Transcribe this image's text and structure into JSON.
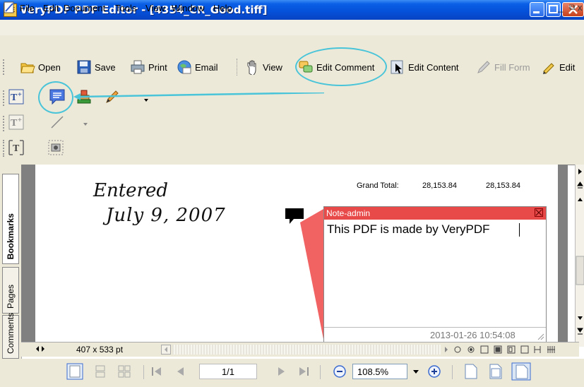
{
  "window": {
    "title": "VeryPDF PDF Editor - [4354_CR_Good.tiff]",
    "app_icon_text": "PE"
  },
  "menu": {
    "items": [
      "File",
      "Edit",
      "Document",
      "Tools",
      "View",
      "Window",
      "Help"
    ],
    "mdi_controls": [
      "_",
      "⧉",
      "x"
    ]
  },
  "toolbar": {
    "open": "Open",
    "save": "Save",
    "print": "Print",
    "email": "Email",
    "view": "View",
    "edit_comment": "Edit Comment",
    "edit_content": "Edit Content",
    "fill_form": "Fill Form",
    "edit": "Edit"
  },
  "side_tabs": [
    "Bookmarks",
    "Pages",
    "Comments"
  ],
  "document": {
    "handwritten_line1": "Entered",
    "handwritten_line2": "July 9, 2007",
    "grand_total_label": "Grand Total:",
    "grand_total_value1": "28,153.84",
    "grand_total_value2": "28,153.84"
  },
  "note": {
    "title": "Note-admin",
    "body": "This PDF is made by VeryPDF",
    "date": "2013-01-26 10:54:08",
    "header_color": "#e84a4a"
  },
  "status": {
    "page_size": "407 x 533 pt",
    "page_field": "1/1",
    "zoom": "108.5%"
  },
  "colors": {
    "highlight": "#49c4d9",
    "titlebar": "#0550d8"
  }
}
